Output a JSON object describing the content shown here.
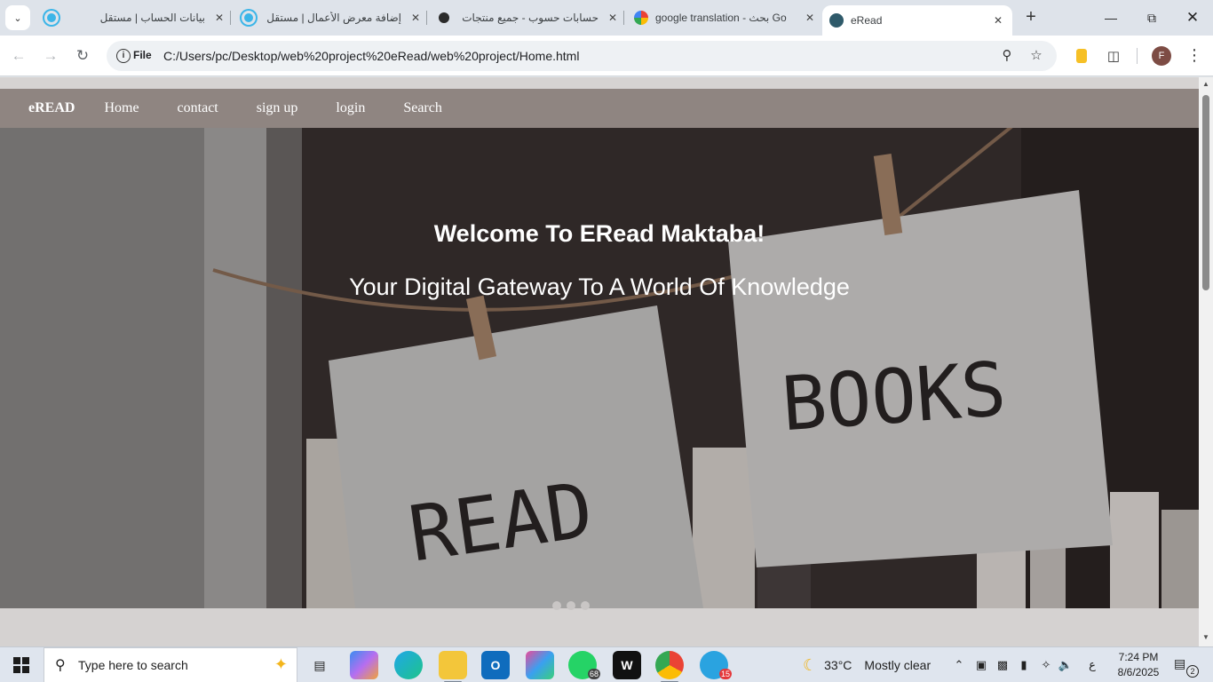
{
  "browser": {
    "tabs": [
      {
        "title": "بيانات الحساب | مستقل",
        "favicon": "mostaql-icon"
      },
      {
        "title": "إضافة معرض الأعمال | مستقل",
        "favicon": "mostaql-icon"
      },
      {
        "title": "حسابات حسوب - جميع منتجات",
        "favicon": "hsoub-icon"
      },
      {
        "title": "google translation - بحث Go",
        "favicon": "google-icon"
      },
      {
        "title": "eRead",
        "favicon": "eread-icon"
      }
    ],
    "active_tab_index": 4,
    "scheme_label": "File",
    "url": "C:/Users/pc/Desktop/web%20project%20eRead/web%20project/Home.html",
    "profile_initial": "F"
  },
  "site": {
    "brand": "eREAD",
    "nav": [
      "Home",
      "contact",
      "sign up",
      "login",
      "Search"
    ],
    "hero": {
      "heading": "Welcome To ERead Maktaba!",
      "subheading": "Your Digital Gateway To A World Of Knowledge",
      "card_left": "READ",
      "card_right": "BOOKS",
      "carousel_dots": 3
    }
  },
  "taskbar": {
    "search_placeholder": "Type here to search",
    "apps": [
      {
        "name": "task-view",
        "badge": ""
      },
      {
        "name": "copilot",
        "badge": ""
      },
      {
        "name": "edge",
        "badge": ""
      },
      {
        "name": "file-explorer",
        "badge": ""
      },
      {
        "name": "outlook",
        "badge": ""
      },
      {
        "name": "msn",
        "badge": ""
      },
      {
        "name": "whatsapp",
        "badge": "68"
      },
      {
        "name": "webstorm",
        "badge": ""
      },
      {
        "name": "chrome",
        "badge": ""
      },
      {
        "name": "telegram",
        "badge": "15"
      }
    ],
    "weather_temp": "33°C",
    "weather_text": "Mostly clear",
    "input_lang": "ع",
    "time": "7:24 PM",
    "date": "8/6/2025",
    "notification_count": "2"
  }
}
